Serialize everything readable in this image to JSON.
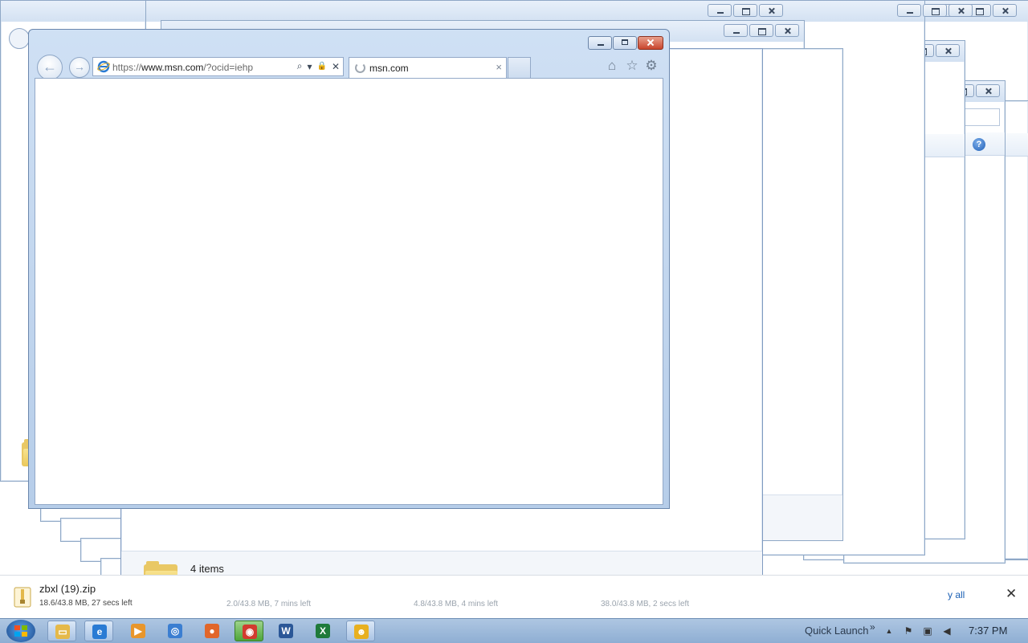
{
  "browser": {
    "url_prefix": "https://",
    "url_host": "www.msn.com",
    "url_path": "/?ocid=iehp",
    "tab_title": "msn.com",
    "tab_close": "×",
    "back_glyph": "←",
    "forward_glyph": "→",
    "home_glyph": "⌂",
    "favorites_glyph": "☆",
    "tools_glyph": "⚙",
    "search_glyph": "⌕",
    "dropdown_glyph": "▾",
    "lock_glyph": "🔒",
    "stop_glyph": "✕"
  },
  "explorer": {
    "status_items": "4 items",
    "help_glyph": "?"
  },
  "downloads": {
    "file_name": "zbxl (19).zip",
    "file_progress": "18.6/43.8 MB, 27 secs left",
    "ghost_1": "2.0/43.8 MB, 7 mins left",
    "ghost_2": "4.8/43.8 MB, 4 mins left",
    "ghost_3": "38.0/43.8 MB, 2 secs left",
    "show_all": "y all",
    "close_glyph": "✕"
  },
  "taskbar": {
    "quick_launch": "Quick Launch",
    "chevron": "»",
    "tray_arrow": "▲",
    "clock": "7:37 PM",
    "apps": [
      {
        "name": "explorer",
        "glyph": "▭",
        "color": "#e5b94a"
      },
      {
        "name": "internet-explorer",
        "glyph": "e",
        "color": "#2a7bd4"
      },
      {
        "name": "media-player",
        "glyph": "▶",
        "color": "#e8962c"
      },
      {
        "name": "chrome-app",
        "glyph": "◎",
        "color": "#3b7ed1"
      },
      {
        "name": "firefox",
        "glyph": "●",
        "color": "#e1662a"
      },
      {
        "name": "chrome",
        "glyph": "◉",
        "color": "#d23b2f"
      },
      {
        "name": "word",
        "glyph": "W",
        "color": "#2b5797"
      },
      {
        "name": "excel",
        "glyph": "X",
        "color": "#1f7a3a"
      },
      {
        "name": "messenger",
        "glyph": "☻",
        "color": "#e8b020"
      }
    ]
  }
}
